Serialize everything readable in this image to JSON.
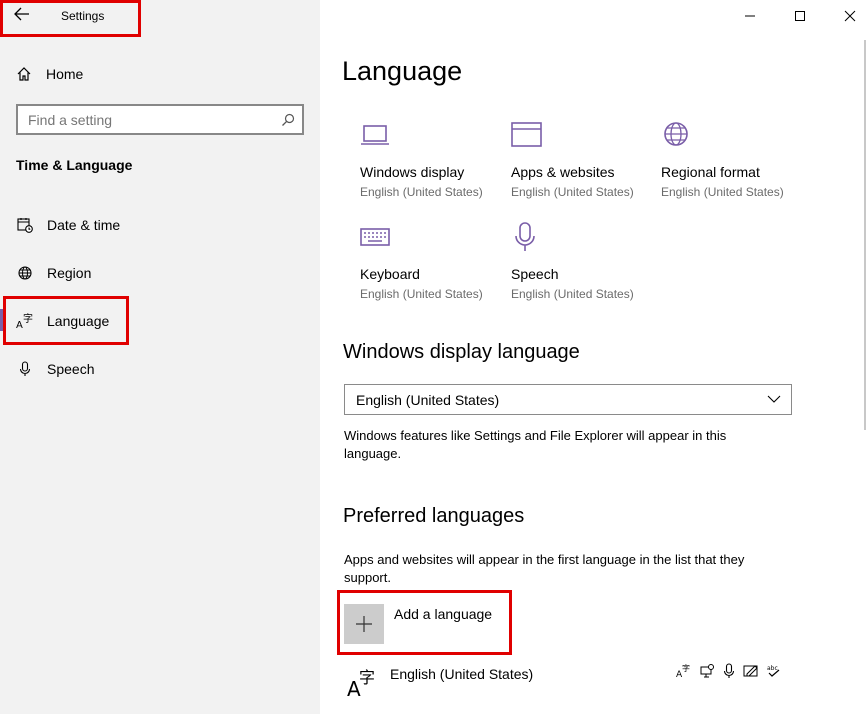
{
  "window": {
    "title": "Settings",
    "controls": [
      "minimize",
      "maximize",
      "close"
    ]
  },
  "sidebar": {
    "home_label": "Home",
    "search_placeholder": "Find a setting",
    "section_title": "Time & Language",
    "items": [
      {
        "label": "Date & time",
        "icon": "calendar-clock-icon"
      },
      {
        "label": "Region",
        "icon": "globe-icon"
      },
      {
        "label": "Language",
        "icon": "language-icon",
        "selected": true
      },
      {
        "label": "Speech",
        "icon": "microphone-icon"
      }
    ]
  },
  "main": {
    "title": "Language",
    "tiles": [
      {
        "label": "Windows display",
        "sub": "English (United States)",
        "icon": "monitor-icon"
      },
      {
        "label": "Apps & websites",
        "sub": "English (United States)",
        "icon": "browser-window-icon"
      },
      {
        "label": "Regional format",
        "sub": "English (United States)",
        "icon": "globe-icon"
      },
      {
        "label": "Keyboard",
        "sub": "English (United States)",
        "icon": "keyboard-icon"
      },
      {
        "label": "Speech",
        "sub": "English (United States)",
        "icon": "microphone-icon"
      }
    ],
    "display_language": {
      "heading": "Windows display language",
      "selected": "English (United States)",
      "description": "Windows features like Settings and File Explorer will appear in this language."
    },
    "preferred": {
      "heading": "Preferred languages",
      "description": "Apps and websites will appear in the first language in the list that they support.",
      "add_label": "Add a language",
      "languages": [
        {
          "name": "English (United States)",
          "features": [
            "display-language-icon",
            "speech-recognition-icon",
            "text-to-speech-icon",
            "handwriting-icon",
            "spellcheck-icon"
          ]
        }
      ]
    }
  },
  "colors": {
    "accent": "#7a5ea8",
    "highlight_border": "#e00000",
    "sidebar_bg": "#f2f2f2"
  }
}
